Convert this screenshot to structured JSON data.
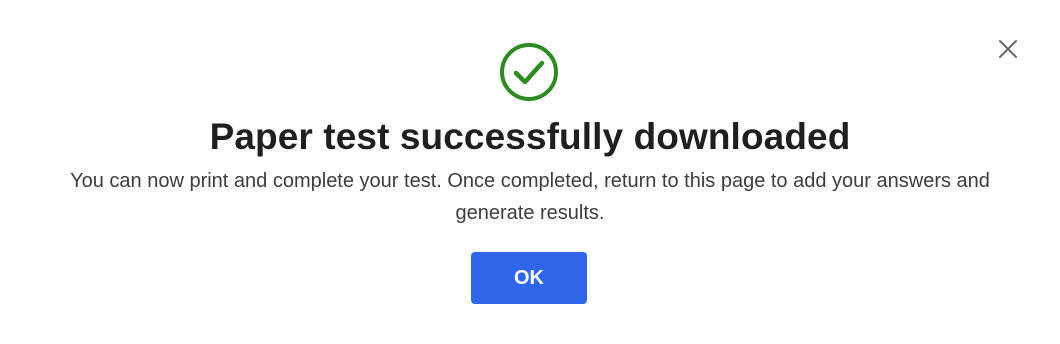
{
  "dialog": {
    "title": "Paper test successfully downloaded",
    "message": "You can now print and complete your test. Once completed, return to this page to add your answers and generate results.",
    "ok_label": "OK",
    "icons": {
      "status": "check-circle-icon",
      "close": "close-icon"
    },
    "colors": {
      "success": "#2e8b23",
      "primary_button": "#2f66e9",
      "close_icon": "#6b6b6b"
    }
  }
}
